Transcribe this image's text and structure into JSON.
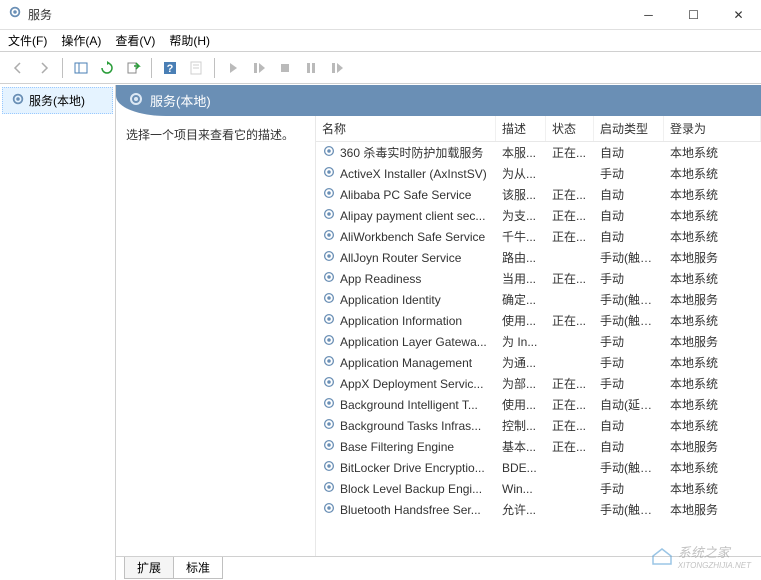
{
  "window": {
    "title": "服务"
  },
  "menu": {
    "file": "文件(F)",
    "action": "操作(A)",
    "view": "查看(V)",
    "help": "帮助(H)"
  },
  "tree": {
    "root": "服务(本地)"
  },
  "pane": {
    "title": "服务(本地)"
  },
  "desc": {
    "hint": "选择一个项目来查看它的描述。"
  },
  "columns": {
    "name": "名称",
    "desc": "描述",
    "status": "状态",
    "startup": "启动类型",
    "logon": "登录为"
  },
  "services": [
    {
      "name": "360 杀毒实时防护加载服务",
      "desc": "本服...",
      "status": "正在...",
      "startup": "自动",
      "logon": "本地系统"
    },
    {
      "name": "ActiveX Installer (AxInstSV)",
      "desc": "为从...",
      "status": "",
      "startup": "手动",
      "logon": "本地系统"
    },
    {
      "name": "Alibaba PC Safe Service",
      "desc": "该服...",
      "status": "正在...",
      "startup": "自动",
      "logon": "本地系统"
    },
    {
      "name": "Alipay payment client sec...",
      "desc": "为支...",
      "status": "正在...",
      "startup": "自动",
      "logon": "本地系统"
    },
    {
      "name": "AliWorkbench Safe Service",
      "desc": "千牛...",
      "status": "正在...",
      "startup": "自动",
      "logon": "本地系统"
    },
    {
      "name": "AllJoyn Router Service",
      "desc": "路由...",
      "status": "",
      "startup": "手动(触发...",
      "logon": "本地服务"
    },
    {
      "name": "App Readiness",
      "desc": "当用...",
      "status": "正在...",
      "startup": "手动",
      "logon": "本地系统"
    },
    {
      "name": "Application Identity",
      "desc": "确定...",
      "status": "",
      "startup": "手动(触发...",
      "logon": "本地服务"
    },
    {
      "name": "Application Information",
      "desc": "使用...",
      "status": "正在...",
      "startup": "手动(触发...",
      "logon": "本地系统"
    },
    {
      "name": "Application Layer Gatewa...",
      "desc": "为 In...",
      "status": "",
      "startup": "手动",
      "logon": "本地服务"
    },
    {
      "name": "Application Management",
      "desc": "为通...",
      "status": "",
      "startup": "手动",
      "logon": "本地系统"
    },
    {
      "name": "AppX Deployment Servic...",
      "desc": "为部...",
      "status": "正在...",
      "startup": "手动",
      "logon": "本地系统"
    },
    {
      "name": "Background Intelligent T...",
      "desc": "使用...",
      "status": "正在...",
      "startup": "自动(延迟...",
      "logon": "本地系统"
    },
    {
      "name": "Background Tasks Infras...",
      "desc": "控制...",
      "status": "正在...",
      "startup": "自动",
      "logon": "本地系统"
    },
    {
      "name": "Base Filtering Engine",
      "desc": "基本...",
      "status": "正在...",
      "startup": "自动",
      "logon": "本地服务"
    },
    {
      "name": "BitLocker Drive Encryptio...",
      "desc": "BDE...",
      "status": "",
      "startup": "手动(触发...",
      "logon": "本地系统"
    },
    {
      "name": "Block Level Backup Engi...",
      "desc": "Win...",
      "status": "",
      "startup": "手动",
      "logon": "本地系统"
    },
    {
      "name": "Bluetooth Handsfree Ser...",
      "desc": "允许...",
      "status": "",
      "startup": "手动(触发...",
      "logon": "本地服务"
    }
  ],
  "tabs": {
    "extended": "扩展",
    "standard": "标准"
  },
  "watermark": {
    "text": "系统之家",
    "sub": "XITONGZHIJIA.NET"
  }
}
